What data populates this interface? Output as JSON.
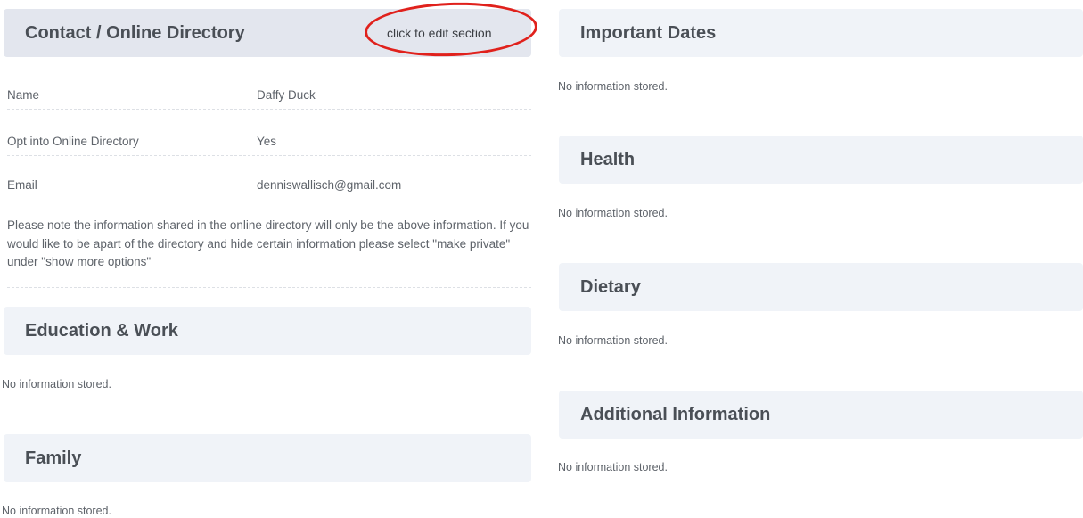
{
  "contact": {
    "title": "Contact / Online Directory",
    "edit_label": "click to edit section",
    "rows": [
      {
        "label": "Name",
        "value": "Daffy Duck"
      },
      {
        "label": "Opt into Online Directory",
        "value": "Yes"
      },
      {
        "label": "Email",
        "value": "denniswallisch@gmail.com"
      }
    ],
    "note": "Please note the information shared in the online directory will only be the above information. If you would like to be apart of the directory and hide certain information please select \"make private\" under \"show more options\""
  },
  "education": {
    "title": "Education & Work",
    "empty": "No information stored."
  },
  "family": {
    "title": "Family",
    "empty": "No information stored."
  },
  "important_dates": {
    "title": "Important Dates",
    "empty": "No information stored."
  },
  "health": {
    "title": "Health",
    "empty": "No information stored."
  },
  "dietary": {
    "title": "Dietary",
    "empty": "No information stored."
  },
  "additional": {
    "title": "Additional Information",
    "empty": "No information stored."
  },
  "colors": {
    "active_header_bg": "#e3e6ee",
    "header_bg": "#f0f3f8",
    "annotation_red": "#e0211c"
  }
}
